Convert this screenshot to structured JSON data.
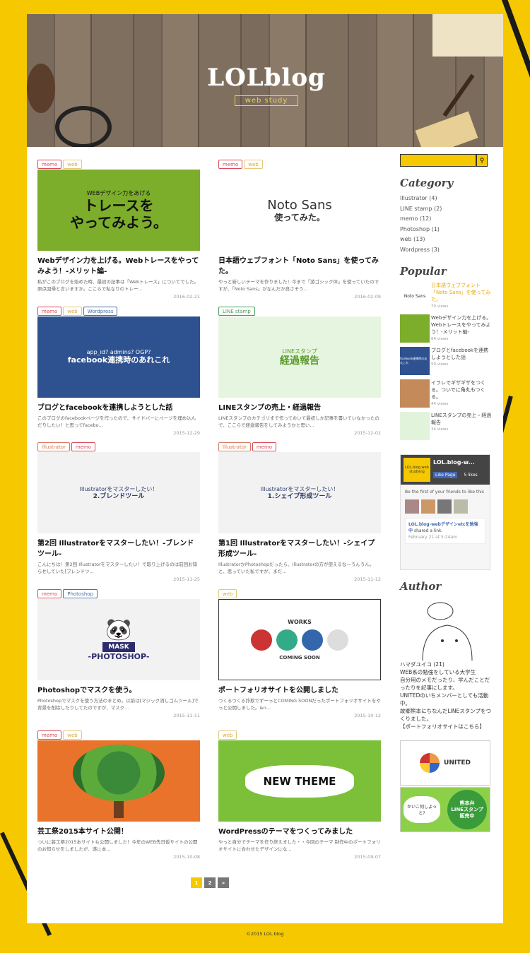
{
  "site": {
    "logo_main": "LOLblog",
    "logo_sub": "web study"
  },
  "posts": [
    {
      "tags": [
        "memo",
        "web"
      ],
      "title": "Webデザイン力を上げる。Webトレースをやってみよう！-メリット編-",
      "excerpt": "私がこのブログを始めた時、最初の記事は「Webトレース」についてでした。原点回帰と言いますか。ここらで私なりのトレー...",
      "date": "2016-02-21",
      "thumb_top": "WEBデザイン力をあげる",
      "thumb_main": "トレースを\nやってみよう。"
    },
    {
      "tags": [
        "memo",
        "web"
      ],
      "title": "日本語ウェブフォント「Noto Sans」を使ってみた。",
      "excerpt": "やっと新しいテーマを作りました！今まで「游ゴシック体」を使っていたのですが、「Noto Sans」がなんだか良さそう...",
      "date": "2016-02-09",
      "thumb_top": "Noto Sans",
      "thumb_main": "使ってみた。"
    },
    {
      "tags": [
        "memo",
        "web",
        "Wordpress"
      ],
      "title": "ブログとfacebookを連携しようとした話",
      "excerpt": "このブログのfacebookページを作ったので、サイドバーにページを埋め込んだりしたい！と思ってfacebo...",
      "date": "2015-12-29",
      "thumb_top": "app_id?  admins?  OGP?",
      "thumb_main": "facebook連携時のあれこれ"
    },
    {
      "tags": [
        "LINE stamp"
      ],
      "title": "LINEスタンプの売上・経過報告",
      "excerpt": "LINEスタンプのカテゴリまで作っておいて最初しか記事を書いていなかったので、ここらで経過報告をしてみようかと思い...",
      "date": "2015-12-02",
      "thumb_top": "LINEスタンプ",
      "thumb_main": "経過報告"
    },
    {
      "tags": [
        "Illustrator",
        "memo"
      ],
      "title": "第2回 Illustratorをマスターしたい！-ブレンドツール-",
      "excerpt": "こんにちは！第2回 Illustratorをマスターしたい！で取り上げるのは前回お知らせしていた[ブレンドツ...",
      "date": "2015-11-25",
      "thumb_top": "Illustratorをマスターしたい！",
      "thumb_main": "2.ブレンドツール"
    },
    {
      "tags": [
        "Illustrator",
        "memo"
      ],
      "title": "第1回 Illustratorをマスターしたい！-シェイプ形成ツール-",
      "excerpt": "IllustratorかPhotoshopだったら、Illustratorの方が使えるな〜うんうん。と、思っていた私ですが、まだ...",
      "date": "2015-11-12",
      "thumb_top": "Illustratorをマスターしたい！",
      "thumb_main": "1.シェイプ形成ツール"
    },
    {
      "tags": [
        "memo",
        "Photoshop"
      ],
      "title": "Photoshopでマスクを使う。",
      "excerpt": "Photoshopでマスクを使う方法のまとめ。以前は[マジック消しゴムツール]で背景を削除したりしてたのですが、マスク...",
      "date": "2015-11-11",
      "thumb_top": "MASK",
      "thumb_main": "-PHOTOSHOP-"
    },
    {
      "tags": [
        "web"
      ],
      "title": "ポートフォリオサイトを公開しました",
      "excerpt": "つくるつくる詐欺でずーっとCOMING SOONだったポートフォリオサイトをやっと公開しました。&n...",
      "date": "2015-10-12",
      "thumb_top": "WORKS",
      "thumb_main": "COMING SOON"
    },
    {
      "tags": [
        "memo",
        "web"
      ],
      "title": "芸工祭2015本サイト公開！",
      "excerpt": "ついに芸工祭2015本サイトも公開しました！今年のWEB先日仮サイトの公開のお知らせをしましたが、遂に本...",
      "date": "2015-10-08",
      "thumb_top": "",
      "thumb_main": ""
    },
    {
      "tags": [
        "web"
      ],
      "title": "WordPressのテーマをつくってみました",
      "excerpt": "やっと自分でテーマを作り終えました・・今回のテーマ 制作中のポートフォリオサイトに合わせたデザインにな...",
      "date": "2015-09-07",
      "thumb_top": "",
      "thumb_main": "NEW THEME"
    }
  ],
  "pagination": [
    "1",
    "2",
    "»"
  ],
  "sidebar": {
    "category_title": "Category",
    "categories": [
      "Illustrator (4)",
      "LINE stamp (2)",
      "memo (12)",
      "Photoshop (1)",
      "web (13)",
      "Wordpress (3)"
    ],
    "popular_title": "Popular",
    "popular": [
      {
        "title": "日本語ウェブフォント「Noto Sans」を使ってみた。",
        "views": "70 views",
        "thumb": "Noto Sans"
      },
      {
        "title": "Webデザイン力を上げる。Webトレースをやってみよう！-メリット編-",
        "views": "64 views",
        "thumb": ""
      },
      {
        "title": "ブログとfacebookを連携しようとした話",
        "views": "50 views",
        "thumb": "facebook連携時のあれこれ"
      },
      {
        "title": "イラレでギザギザをつくる。ついでに角丸もつくる。",
        "views": "44 views",
        "thumb": ""
      },
      {
        "title": "LINEスタンプの売上・経過報告",
        "views": "34 views",
        "thumb": ""
      }
    ],
    "fb": {
      "page_name": "LOL.blog-w...",
      "logo": "LOL.blog web studying",
      "like": "Like Page",
      "likes": "5 likes",
      "friends": "Be the first of your friends to like this",
      "post_name": "LOL.blog-webデザインetcを勉強中",
      "post_action": "shared a link.",
      "post_date": "February 21 at 5:24am"
    },
    "author_title": "Author",
    "author_lines": [
      "ハマダユイコ (21)",
      "WEB系の勉強をしている大学生",
      "自分用のメモだったり、学んだことだったりを記事にします。",
      "UNITEDのいちメンバーとしても活動中。",
      "故郷熊本にちなんだLINEスタンプをつくりました。",
      "【ポートフォリオサイトはこちら】"
    ],
    "banner1": "UNITED",
    "banner2_bubble": "かいこ何しよっと?",
    "banner2": "熊本弁\nLINEスタンプ\n販売中"
  },
  "footer": "©2015 LOL.blog"
}
